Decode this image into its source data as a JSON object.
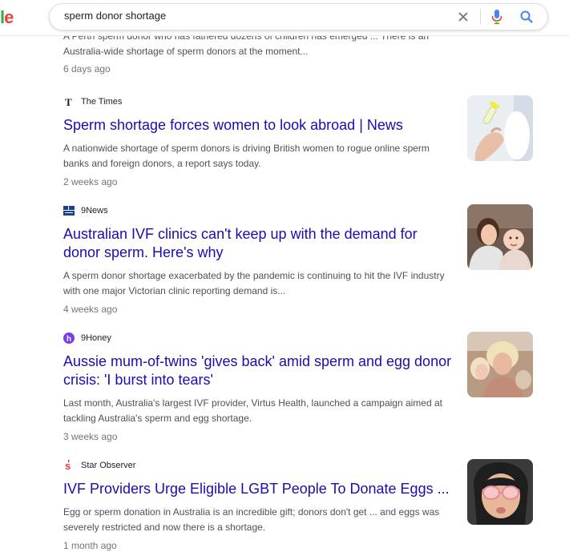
{
  "search": {
    "query": "sperm donor shortage"
  },
  "logo": {
    "partial_text_l": "l",
    "partial_text_e": "e"
  },
  "top_result": {
    "snippet": "A Perth sperm donor who has fathered dozens of children has emerged ... There is an Australia-wide shortage of sperm donors at the moment...",
    "date": "6 days ago"
  },
  "results": [
    {
      "source": "The Times",
      "source_icon": "the-times-icon",
      "title": "Sperm shortage forces women to look abroad | News",
      "snippet": "A nationwide shortage of sperm donors is driving British women to rogue online sperm banks and foreign donors, a report says today.",
      "date": "2 weeks ago",
      "thumbnail": "test-tube-hand-thumbnail"
    },
    {
      "source": "9News",
      "source_icon": "9news-icon",
      "title": "Australian IVF clinics can't keep up with the demand for donor sperm. Here's why",
      "snippet": "A sperm donor shortage exacerbated by the pandemic is continuing to hit the IVF industry with one major Victorian clinic reporting demand is...",
      "date": "4 weeks ago",
      "thumbnail": "mother-baby-thumbnail"
    },
    {
      "source": "9Honey",
      "source_icon": "9honey-icon",
      "title": "Aussie mum-of-twins 'gives back' amid sperm and egg donor crisis: 'I burst into tears'",
      "snippet": "Last month, Australia's largest IVF provider, Virtus Health, launched a campaign aimed at tackling Australia's sperm and egg shortage.",
      "date": "3 weeks ago",
      "thumbnail": "mum-twins-thumbnail"
    },
    {
      "source": "Star Observer",
      "source_icon": "star-observer-icon",
      "title": "IVF Providers Urge Eligible LGBT People To Donate Eggs ...",
      "snippet": "Egg or sperm donation in Australia is an incredible gift; donors don't get ... and eggs was severely restricted and now there is a shortage.",
      "date": "1 month ago",
      "thumbnail": "child-glasses-thumbnail"
    }
  ],
  "colors": {
    "link": "#1a0dab",
    "snippet": "#4d5156",
    "date": "#70757a",
    "google_blue": "#4285f4"
  }
}
